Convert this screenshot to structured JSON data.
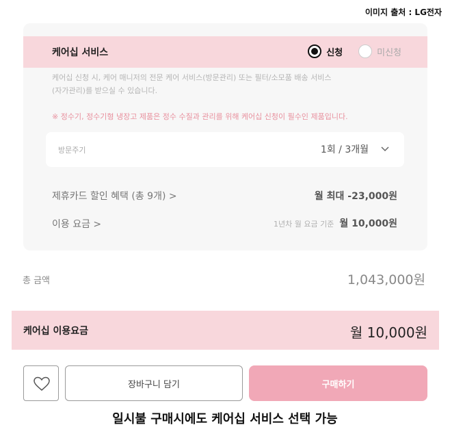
{
  "source": "이미지 출처 : LG전자",
  "care": {
    "title": "케어십 서비스",
    "option_on": "신청",
    "option_off": "미신청",
    "desc_line1": "케어십 신청 시, 케어 매니저의 전문 케어 서비스(방문관리) 또는 필터/소모품 배송 서비스",
    "desc_line2": "(자가관리)를 받으실 수 있습니다.",
    "notice": "※ 정수기, 정수기형 냉장고 제품은 정수 수질과 관리를 위해 케어십 신청이 필수인 제품입니다.",
    "visit_label": "방문주기",
    "visit_value": "1회 / 3개월",
    "card_label": "제휴카드 할인 혜택 (총 9개) >",
    "card_value": "월 최대 -23,000원",
    "fee_label": "이용 요금 >",
    "fee_sub": "1년차 월 요금 기준",
    "fee_value": "월 10,000원"
  },
  "total": {
    "label": "총 금액",
    "value": "1,043,000원"
  },
  "monthly": {
    "label": "케어십 이용요금",
    "value": "월 10,000원"
  },
  "buttons": {
    "cart": "장바구니 담기",
    "buy": "구매하기"
  },
  "caption": "일시불 구매시에도 케어십 서비스 선택 가능",
  "colors": {
    "pink_bg": "#f8d7dc",
    "buy_button": "#f1a8b7",
    "notice": "#e8909e"
  }
}
